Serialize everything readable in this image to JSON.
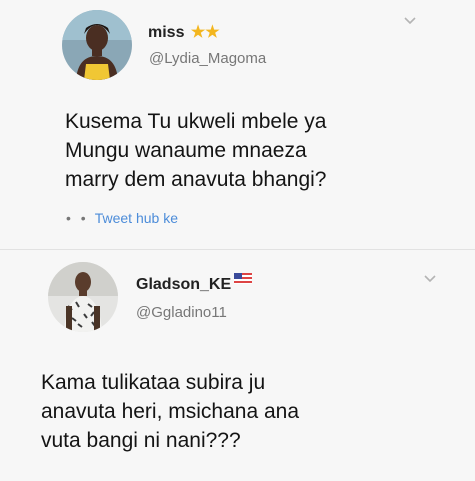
{
  "tweets": [
    {
      "display_name": "miss",
      "badge_icons": [
        "star-icon",
        "star-icon"
      ],
      "handle": "@Lydia_Magoma",
      "text_lines": [
        "Kusema Tu ukweli mbele ya",
        "Mungu wanaume mnaeza",
        "marry dem anavuta bhangi?"
      ],
      "source_dots": "• •",
      "source_label": "Tweet hub ke"
    },
    {
      "display_name": "Gladson_KE",
      "badge_icons": [
        "flag-icon"
      ],
      "handle": "@Ggladino11",
      "text_lines": [
        "Kama tulikataa subira ju",
        "anavuta heri, msichana ana",
        "vuta bangi ni nani???"
      ]
    }
  ],
  "colors": {
    "background": "#f7f7f7",
    "handle": "#777777",
    "source_link": "#4c8cd9",
    "star": "#f3b61f"
  }
}
